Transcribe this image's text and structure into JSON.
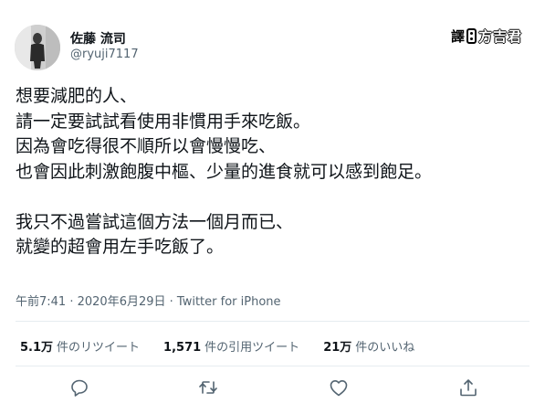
{
  "author": {
    "display_name": "佐藤 流司",
    "handle": "@ryuji7117",
    "avatar_icon": "avatar"
  },
  "watermark": {
    "prefix": "譯",
    "main": "方吉君"
  },
  "tweet": {
    "lines": [
      "想要減肥的人、",
      "請一定要試試看使用非慣用手來吃飯。",
      "因為會吃得很不順所以會慢慢吃、",
      "也會因此刺激飽腹中樞、少量的進食就可以感到飽足。",
      "",
      "我只不過嘗試這個方法一個月而已、",
      "就變的超會用左手吃飯了。"
    ]
  },
  "meta": {
    "time": "午前7:41",
    "separator": " · ",
    "date": "2020年6月29日",
    "source": "Twitter for iPhone"
  },
  "stats": {
    "retweets_count": "5.1万",
    "retweets_label": "件のリツイート",
    "quotes_count": "1,571",
    "quotes_label": "件の引用ツイート",
    "likes_count": "21万",
    "likes_label": "件のいいね"
  },
  "actions": {
    "reply_icon": "reply-icon",
    "retweet_icon": "retweet-icon",
    "like_icon": "heart-icon",
    "share_icon": "share-icon"
  },
  "colors": {
    "text": "#0f1419",
    "secondary": "#536471",
    "divider": "#e6ecf0"
  }
}
